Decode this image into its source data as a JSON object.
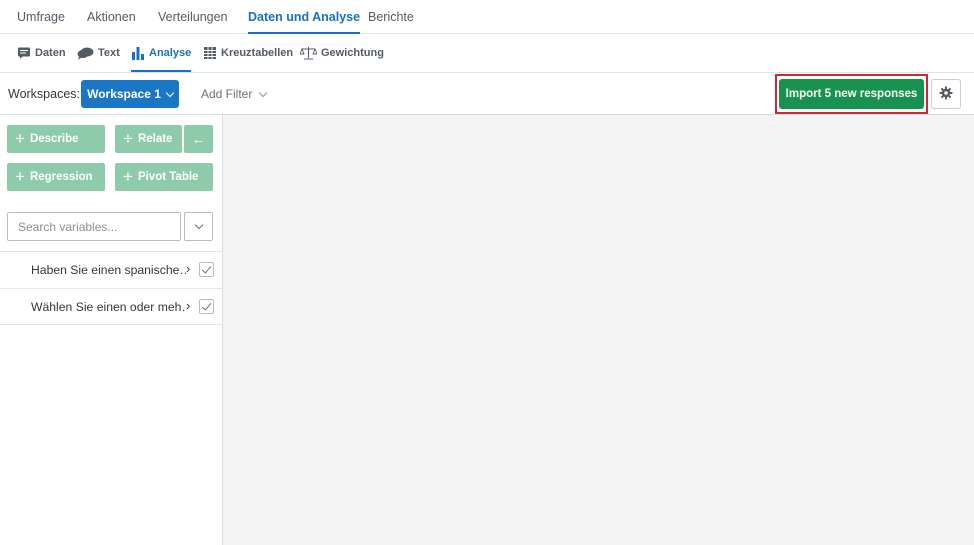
{
  "top_tabs": [
    {
      "label": "Umfrage"
    },
    {
      "label": "Aktionen"
    },
    {
      "label": "Verteilungen"
    },
    {
      "label": "Daten und Analyse",
      "active": true
    },
    {
      "label": "Berichte"
    }
  ],
  "sub_tabs": [
    {
      "label": "Daten",
      "icon": "speech-bubble-icon"
    },
    {
      "label": "Text",
      "icon": "chat-bubbles-icon"
    },
    {
      "label": "Analyse",
      "icon": "bar-chart-icon",
      "active": true
    },
    {
      "label": "Kreuztabellen",
      "icon": "grid-icon"
    },
    {
      "label": "Gewichtung",
      "icon": "scale-icon"
    }
  ],
  "toolbar": {
    "workspaces_label": "Workspaces:",
    "workspace_selected": "Workspace 1",
    "add_filter": "Add Filter",
    "import_button": "Import 5 new responses"
  },
  "actions": {
    "describe": "Describe",
    "relate": "Relate",
    "back_arrow": "←",
    "regression": "Regression",
    "pivot_table": "Pivot Table"
  },
  "search": {
    "placeholder": "Search variables..."
  },
  "variables": [
    {
      "label": "Haben Sie einen spanische…",
      "checked": true
    },
    {
      "label": "Wählen Sie einen oder meh…",
      "checked": true
    }
  ],
  "colors": {
    "accent_blue": "#1b76c5",
    "import_green": "#18934f",
    "action_green": "#8dcbab",
    "highlight_red": "#c8283a"
  }
}
